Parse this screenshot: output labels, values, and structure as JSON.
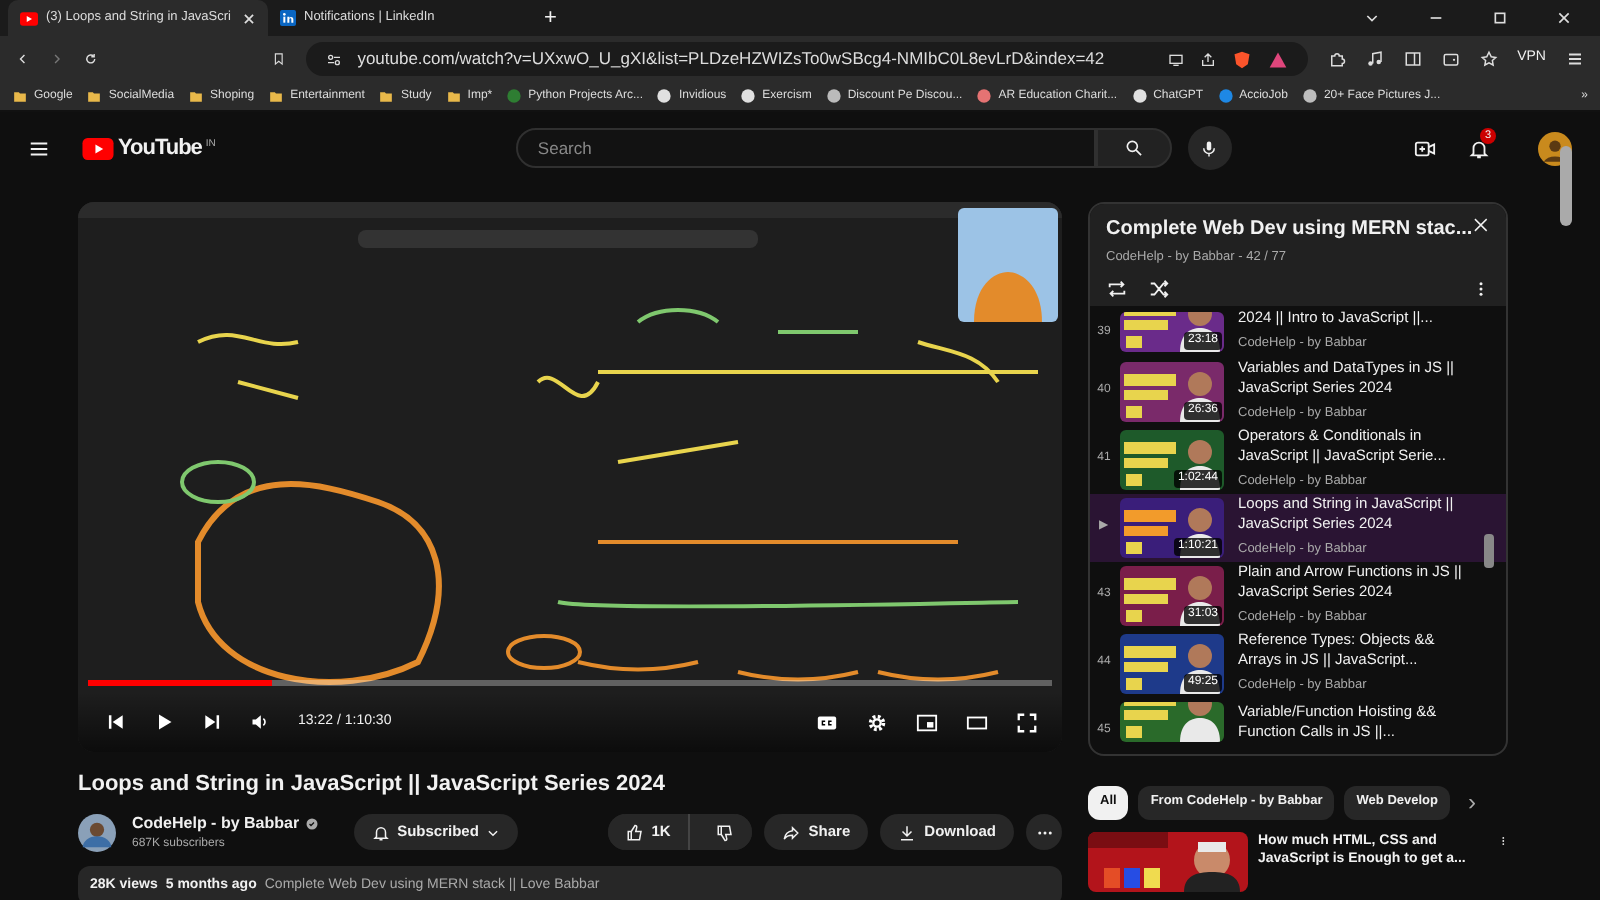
{
  "browser": {
    "tabs": [
      {
        "title": "(3) Loops and String in JavaScri",
        "kind": "youtube",
        "selected": true
      },
      {
        "title": "Notifications | LinkedIn",
        "kind": "linkedin",
        "selected": false
      }
    ],
    "new_tab": "+",
    "url": "youtube.com/watch?v=UXxwO_U_gXI&list=PLDzeHZWIZsTo0wSBcg4-NMIbC0L8evLrD&index=42",
    "vpn": "VPN",
    "bookmarks": [
      {
        "label": "Google",
        "kind": "folder"
      },
      {
        "label": "SocialMedia",
        "kind": "folder"
      },
      {
        "label": "Shoping",
        "kind": "folder"
      },
      {
        "label": "Entertainment",
        "kind": "folder"
      },
      {
        "label": "Study",
        "kind": "folder"
      },
      {
        "label": "Imp*",
        "kind": "folder"
      },
      {
        "label": "Python Projects Arc...",
        "kind": "site"
      },
      {
        "label": "Invidious",
        "kind": "site"
      },
      {
        "label": "Exercism",
        "kind": "site"
      },
      {
        "label": "Discount Pe Discou...",
        "kind": "site"
      },
      {
        "label": "AR Education Charit...",
        "kind": "site"
      },
      {
        "label": "ChatGPT",
        "kind": "site"
      },
      {
        "label": "AccioJob",
        "kind": "site"
      },
      {
        "label": "20+ Face Pictures J...",
        "kind": "site"
      }
    ],
    "more_bookmarks": "»"
  },
  "header": {
    "logo": "YouTube",
    "region": "IN",
    "search_placeholder": "Search",
    "notification_count": "3"
  },
  "player": {
    "level": 0.19,
    "time": "13:22 / 1:10:30"
  },
  "video": {
    "title": "Loops and String in JavaScript || JavaScript Series 2024",
    "channel": "CodeHelp - by Babbar",
    "subscribers": "687K subscribers",
    "subscribe": "Subscribed",
    "likes": "1K",
    "share": "Share",
    "download": "Download",
    "views": "28K views",
    "age": "5 months ago",
    "description": "Complete Web Dev using MERN stack || Love Babbar"
  },
  "playlist": {
    "title": "Complete Web Dev using MERN stac...",
    "meta": "CodeHelp - by Babbar - 42 / 77",
    "items": [
      {
        "index": "39",
        "duration": "23:18",
        "title": "2024 || Intro to JavaScript ||...",
        "channel": "CodeHelp - by Babbar",
        "kind": "cut-top",
        "selected": false
      },
      {
        "index": "40",
        "duration": "26:36",
        "title": "Variables and DataTypes in JS || JavaScript Series 2024",
        "channel": "CodeHelp - by Babbar",
        "kind": "full",
        "selected": false
      },
      {
        "index": "41",
        "duration": "1:02:44",
        "title": "Operators & Conditionals in JavaScript || JavaScript Serie...",
        "channel": "CodeHelp - by Babbar",
        "kind": "full",
        "selected": false
      },
      {
        "index": "▶",
        "duration": "1:10:21",
        "title": "Loops and String in JavaScript || JavaScript Series 2024",
        "channel": "CodeHelp - by Babbar",
        "kind": "full",
        "selected": true
      },
      {
        "index": "43",
        "duration": "31:03",
        "title": "Plain and Arrow Functions in JS || JavaScript Series 2024",
        "channel": "CodeHelp - by Babbar",
        "kind": "full",
        "selected": false
      },
      {
        "index": "44",
        "duration": "49:25",
        "title": "Reference Types: Objects && Arrays in JS || JavaScript...",
        "channel": "CodeHelp - by Babbar",
        "kind": "full",
        "selected": false
      },
      {
        "index": "45",
        "title": "Variable/Function Hoisting && Function Calls in JS ||...",
        "kind": "cut-bottom",
        "selected": false
      }
    ]
  },
  "chips": [
    {
      "label": "All",
      "selected": true
    },
    {
      "label": "From CodeHelp - by Babbar",
      "selected": false
    },
    {
      "label": "Web Develop",
      "selected": false
    }
  ],
  "chips_next": "›",
  "recommendation": {
    "title": "How much HTML, CSS and JavaScript is Enough to get a..."
  }
}
